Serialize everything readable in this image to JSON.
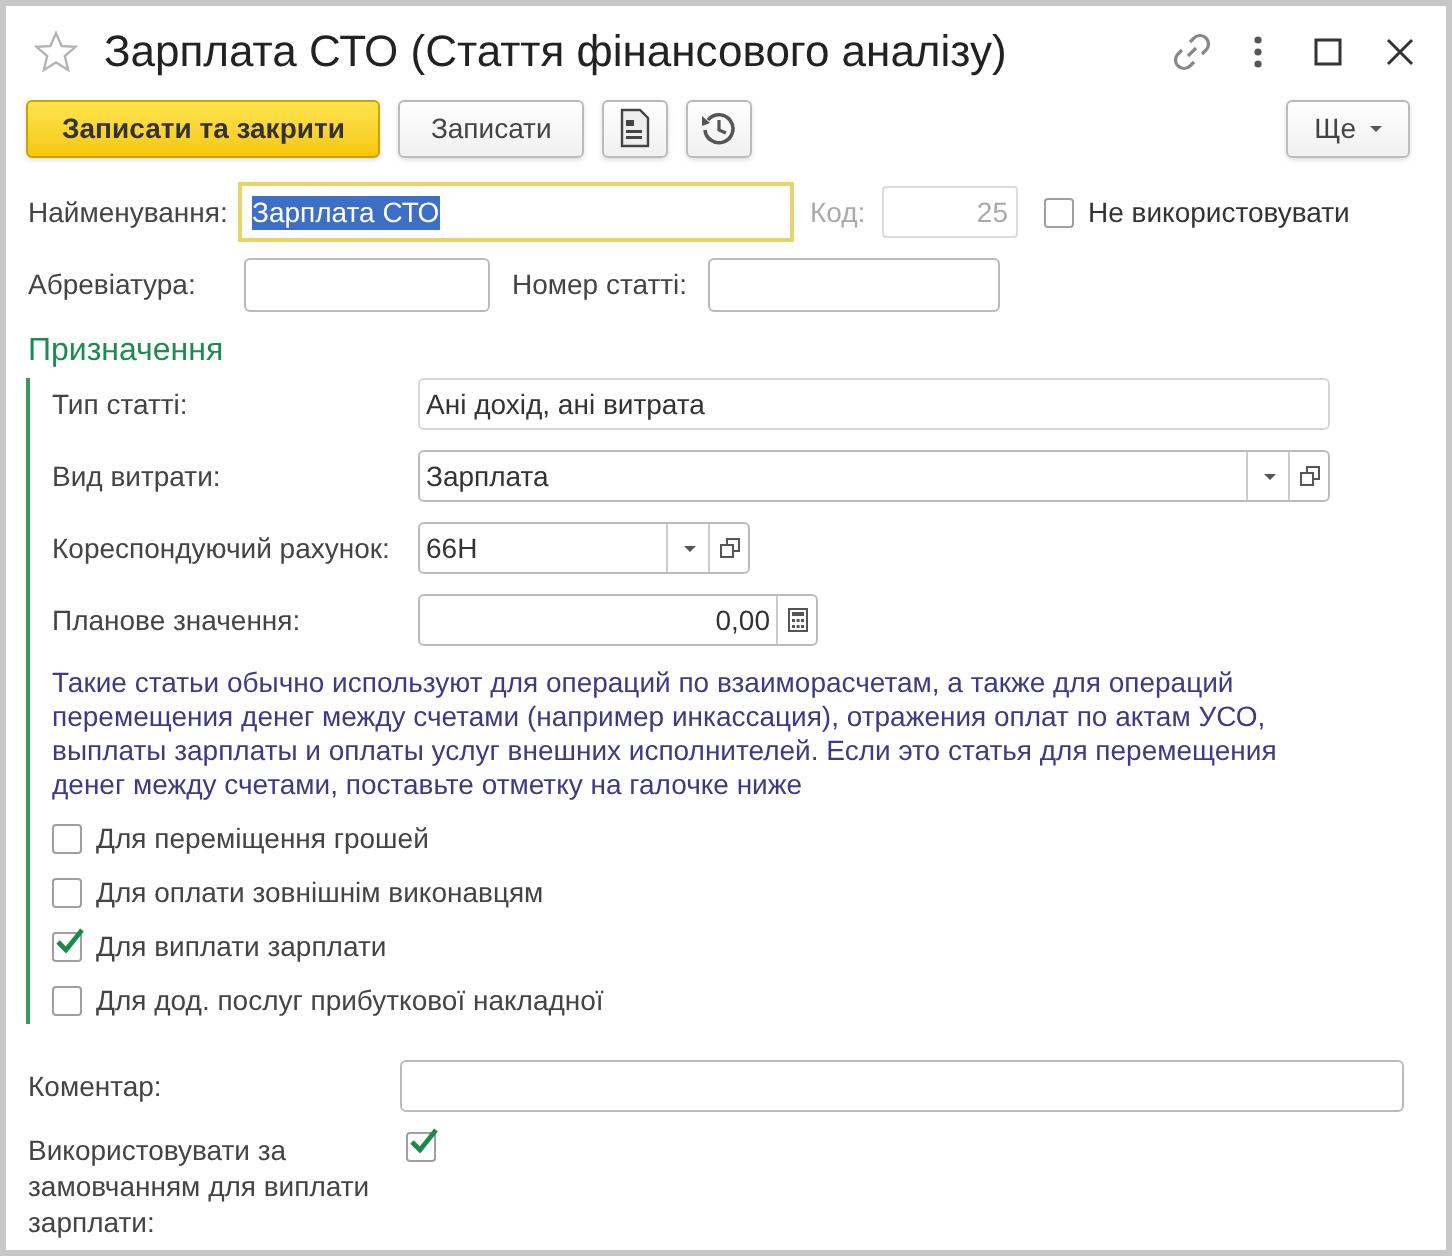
{
  "window": {
    "title": "Зарплата СТО (Стаття фінансового аналізу)"
  },
  "toolbar": [
    {
      "kind": "primary",
      "label": "Записати та закрити"
    },
    {
      "kind": "default",
      "label": "Записати"
    },
    {
      "kind": "report"
    },
    {
      "kind": "history"
    }
  ],
  "more_button": {
    "label": "Ще"
  },
  "header": {
    "name": {
      "label": "Найменування:",
      "value": "Зарплата СТО"
    },
    "code": {
      "label": "Код:",
      "value": "25",
      "disabled": true
    },
    "not_used": {
      "label": "Не використовувати",
      "checked": false
    },
    "abbreviation": {
      "label": "Абревіатура:"
    },
    "article_number": {
      "label": "Номер статті:"
    }
  },
  "section": {
    "title": "Призначення",
    "fields": [
      {
        "kind": "readonly",
        "label": "Тип статті:",
        "value": "Ані дохід, ані витрата"
      },
      {
        "kind": "select",
        "label": "Вид витрати:",
        "value": "Зарплата"
      },
      {
        "kind": "select_short",
        "label": "Кореспондуючий рахунок:",
        "value": "66Н"
      },
      {
        "kind": "number",
        "label": "Планове значення:",
        "value": "0,00"
      }
    ],
    "note": "Такие статьи обычно используют для операций по взаиморасчетам, а также для операций перемещения денег между счетами (например инкассация), отражения оплат по актам УСО, выплаты зарплаты и оплаты услуг внешних исполнителей. Если это статья для перемещения денег между счетами, поставьте отметку на галочке ниже",
    "checkboxes": [
      {
        "label": "Для переміщення грошей",
        "checked": false
      },
      {
        "label": "Для оплати зовнішнім виконавцям",
        "checked": false
      },
      {
        "label": "Для виплати зарплати",
        "checked": true
      },
      {
        "label": "Для дод. послуг прибуткової накладної",
        "checked": false
      }
    ]
  },
  "comment": {
    "label": "Коментар:"
  },
  "default_for_salary": {
    "label": "Використовувати за замовчанням для виплати зарплати:",
    "checked": true
  }
}
